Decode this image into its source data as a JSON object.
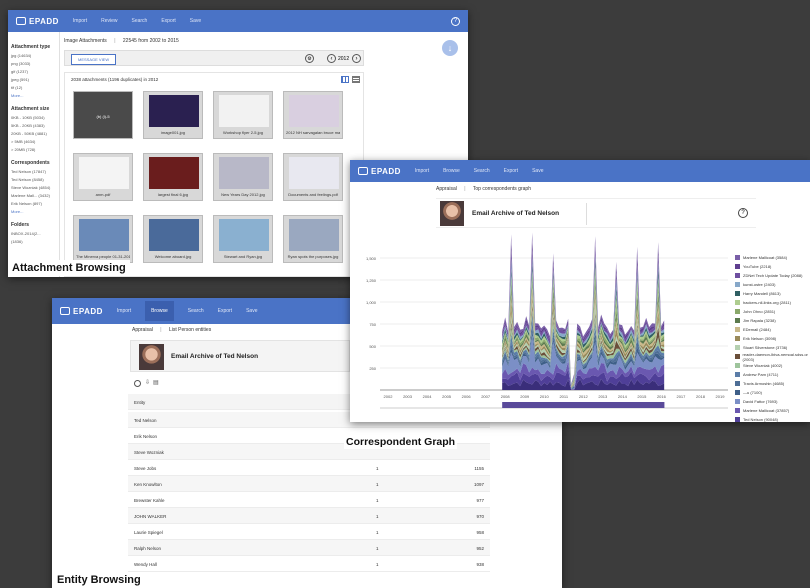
{
  "brand": "EPADD",
  "attachment": {
    "nav": [
      "Import",
      "Review",
      "Search",
      "Export",
      "Save"
    ],
    "breadcrumb": "Image Attachments",
    "range": "22545 from 2002 to 2015",
    "message_view": "MESSAGE VIEW",
    "year": "2012",
    "summary": "2038 attachments (1196 duplicates) in 2012",
    "sidebar": [
      {
        "title": "Attachment type",
        "items": [
          "jpg (14634)",
          "png (3033)",
          "gif (1237)",
          "jpeg (591)",
          "tif (12)",
          "More..."
        ]
      },
      {
        "title": "Attachment size",
        "items": [
          "0KB - 10KB (5034)",
          "5KB - 20KB (4383)",
          "20KB - 50KB (4881)",
          "> 5MB (4634)",
          "> 20MB (728)"
        ]
      },
      {
        "title": "Correspondents",
        "items": [
          "Ted Nelson (17847)",
          "Ted Nelson (8458)",
          "Steve Wozniak (4854)",
          "Marlene Mall... (3432)",
          "Erik Nelson (897)",
          "More..."
        ]
      },
      {
        "title": "Folders",
        "items": [
          "INBOX-2014(2...",
          "(1836)"
        ]
      }
    ],
    "thumbs": [
      "(b) (i)-5",
      "image001.jpg",
      "Workshop flyer 2-5.jpg",
      "2012 NH sarvagalan bruce mail...",
      "anm-pdf",
      "largest final 6.jpg",
      "New Years Day 2012.jpg",
      "Documents and feelings.pdf",
      "The Minerva people 01-31-2012...",
      "Welcome aboard.jpg",
      "Stewart and Ryan.jpg",
      "Ryan spots the purposes.jpg"
    ],
    "caption": "Attachment Browsing"
  },
  "graph": {
    "nav": [
      "Import",
      "Browse",
      "Search",
      "Export",
      "Save"
    ],
    "breadcrumb": [
      "Appraisal",
      "Top correspondents graph"
    ],
    "archive_title": "Email Archive of Ted Nelson",
    "caption": "Correspondent Graph",
    "yticks": [
      "1,500",
      "1,250",
      "1,000",
      "750",
      "500",
      "250"
    ],
    "legend": [
      {
        "label": "Marlene Mallicoat (3584)",
        "color": "#7a5fa8"
      },
      {
        "label": "YouTube (2218)",
        "color": "#5f3f8f"
      },
      {
        "label": "ZDNet Tech Update Today (2088)",
        "color": "#6e4fa0"
      },
      {
        "label": "kunst-ostre (2403)",
        "color": "#87a8c9"
      },
      {
        "label": "Harry Mandell (8613)",
        "color": "#2f5f63"
      },
      {
        "label": "hackers-nll-links.org (2811)",
        "color": "#aecd8f"
      },
      {
        "label": "John Ohno (2851)",
        "color": "#8aa86a"
      },
      {
        "label": "Jim Rapala (3238)",
        "color": "#5c7a4e"
      },
      {
        "label": "EDemail (2484)",
        "color": "#c9b98a"
      },
      {
        "label": "Erik Nelson (3098)",
        "color": "#9a8a5a"
      },
      {
        "label": "Stuart Silverstone (3736)",
        "color": "#b5d0b0"
      },
      {
        "label": "reader-daemon-lbiva-nemoal.sdss.or (2003)",
        "color": "#6b4f3a"
      },
      {
        "label": "Steve Wozniak (4002)",
        "color": "#9ec49c"
      },
      {
        "label": "Andrew Pam (4711)",
        "color": "#5b7da8"
      },
      {
        "label": "Travis Armoshin (4685)",
        "color": "#4e6e96"
      },
      {
        "label": "—u (7100)",
        "color": "#3e5f88"
      },
      {
        "label": "David Fattor (7693)",
        "color": "#7b8fc6"
      },
      {
        "label": "Marlene Mallicoat (37857)",
        "color": "#6a58b0"
      },
      {
        "label": "Ted Nelson (90048)",
        "color": "#4f3f98"
      },
      {
        "label": "Ted Nelson (126797)",
        "color": "#3a2e7a"
      }
    ],
    "xticks": [
      "2002",
      "2003",
      "2004",
      "2005",
      "2006",
      "2007",
      "2008",
      "2009",
      "2010",
      "2011",
      "2012",
      "2013",
      "2014",
      "2015",
      "2016",
      "2017",
      "2018",
      "2019"
    ]
  },
  "entity": {
    "nav": [
      "Import",
      "Browse",
      "Search",
      "Export",
      "Save"
    ],
    "breadcrumb": [
      "Appraisal",
      "List Person entities"
    ],
    "archive_title": "Email Archive of Ted Nelson",
    "column": "Entity",
    "rows": [
      {
        "name": "Ted Nelson",
        "a": "",
        "b": ""
      },
      {
        "name": "Erik Nelson",
        "a": "",
        "b": ""
      },
      {
        "name": "Steve Wozniak",
        "a": "",
        "b": ""
      },
      {
        "name": "Steve Jobs",
        "a": "1",
        "b": "1155"
      },
      {
        "name": "Ken Knowlton",
        "a": "1",
        "b": "1097"
      },
      {
        "name": "Brewster Kahle",
        "a": "1",
        "b": "977"
      },
      {
        "name": "JOHN WALKER",
        "a": "1",
        "b": "970"
      },
      {
        "name": "Laurie Spiegel",
        "a": "1",
        "b": "958"
      },
      {
        "name": "Ralph Nelson",
        "a": "1",
        "b": "952"
      },
      {
        "name": "Wendy Hall",
        "a": "1",
        "b": "938"
      }
    ],
    "caption": "Entity Browsing"
  }
}
